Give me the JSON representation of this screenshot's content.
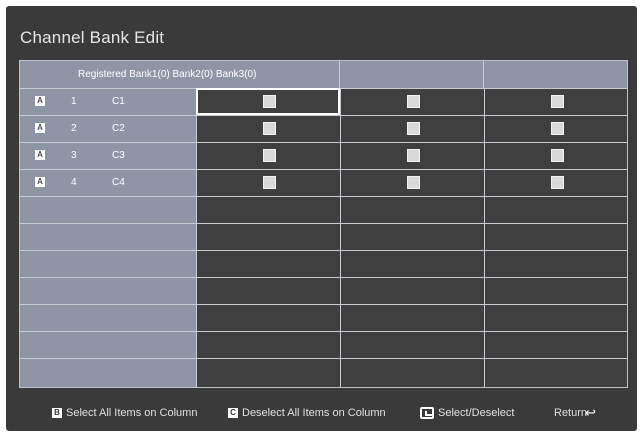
{
  "screen": {
    "title": "Channel Bank Edit"
  },
  "table": {
    "header": "Registered Bank1(0) Bank2(0) Bank3(0)",
    "rows": [
      {
        "badge": "A",
        "number": "1",
        "channel": "C1"
      },
      {
        "badge": "A",
        "number": "2",
        "channel": "C2"
      },
      {
        "badge": "A",
        "number": "3",
        "channel": "C3"
      },
      {
        "badge": "A",
        "number": "4",
        "channel": "C4"
      }
    ]
  },
  "footer": {
    "select_all_key": "B",
    "select_all": "Select All Items on Column",
    "deselect_all_key": "C",
    "deselect_all": "Deselect All Items on Column",
    "select_deselect": "Select/Deselect",
    "return": "Return"
  }
}
